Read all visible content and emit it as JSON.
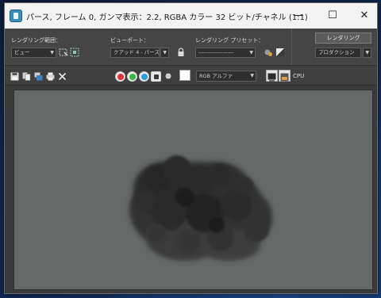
{
  "window": {
    "title": "パース, フレーム 0, ガンマ表示：2.2, RGBA カラー 32 ビット/チャネル (1:1)"
  },
  "controls": {
    "minimize": "—",
    "maximize": "☐",
    "close": "✕"
  },
  "toolbar": {
    "render_area_label": "レンダリング範囲：",
    "render_area_value": "ビュー",
    "viewport_label": "ビューポート：",
    "viewport_value": "クアッド 4 - パース",
    "preset_label": "レンダリング プリセット：",
    "preset_value": "-------------------",
    "render_button": "レンダリング",
    "production_value": "プロダクション"
  },
  "toolbar2": {
    "channel_value": "RGB アルファ",
    "cpu_label": "CPU"
  },
  "colors": {
    "red": "#e0303a",
    "green": "#39b54a",
    "blue": "#2f9fd8"
  }
}
